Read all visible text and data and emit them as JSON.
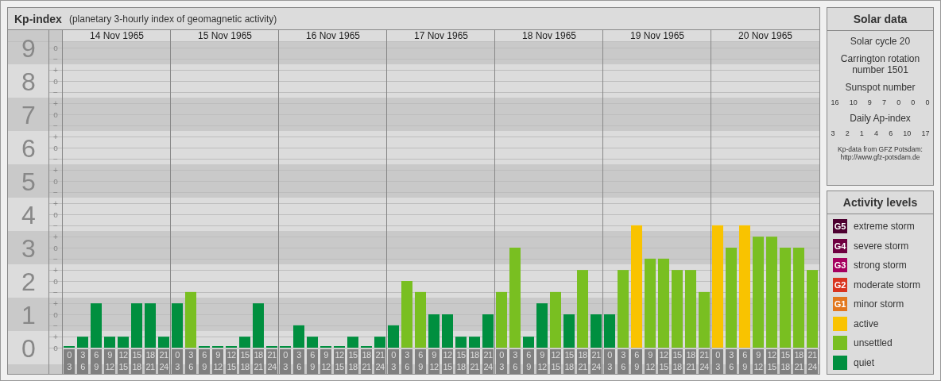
{
  "header": {
    "title": "Kp-index",
    "subtitle": "(planetary 3-hourly index of geomagnetic activity)"
  },
  "kp_subticks": [
    "o",
    "−",
    "+",
    "o",
    "−",
    "+",
    "o",
    "−",
    "+",
    "o",
    "−",
    "+",
    "o",
    "−",
    "+",
    "o",
    "−",
    "+",
    "o",
    "−",
    "+",
    "o",
    "−",
    "+",
    "o",
    "−",
    "+",
    "o"
  ],
  "days": [
    {
      "date": "14 Nov 1965"
    },
    {
      "date": "15 Nov 1965"
    },
    {
      "date": "16 Nov 1965"
    },
    {
      "date": "17 Nov 1965"
    },
    {
      "date": "18 Nov 1965"
    },
    {
      "date": "19 Nov 1965"
    },
    {
      "date": "20 Nov 1965"
    }
  ],
  "chart_data": {
    "type": "bar",
    "ylim": [
      0,
      9.5
    ],
    "yticks": [
      0,
      1,
      2,
      3,
      4,
      5,
      6,
      7,
      8,
      9
    ],
    "grid": true,
    "categories": [
      "0\n3",
      "3\n6",
      "6\n9",
      "9\n12",
      "12\n15",
      "15\n18",
      "18\n21",
      "21\n24",
      "0\n3",
      "3\n6",
      "6\n9",
      "9\n12",
      "12\n15",
      "15\n18",
      "18\n21",
      "21\n24",
      "0\n3",
      "3\n6",
      "6\n9",
      "9\n12",
      "12\n15",
      "15\n18",
      "18\n21",
      "21\n24",
      "0\n3",
      "3\n6",
      "6\n9",
      "9\n12",
      "12\n15",
      "15\n18",
      "18\n21",
      "21\n24",
      "0\n3",
      "3\n6",
      "6\n9",
      "9\n12",
      "12\n15",
      "15\n18",
      "18\n21",
      "21\n24",
      "0\n3",
      "3\n6",
      "6\n9",
      "9\n12",
      "12\n15",
      "15\n18",
      "18\n21",
      "21\n24",
      "0\n3",
      "3\n6",
      "6\n9",
      "9\n12",
      "12\n15",
      "15\n18",
      "18\n21",
      "21\n24"
    ],
    "series": [
      {
        "color": "#008f3f",
        "values": [
          0,
          0.33,
          1.33,
          0.33,
          0.33,
          1.33,
          1.33,
          0.33,
          1.33,
          null,
          0,
          0,
          0,
          0.33,
          1.33,
          0,
          0,
          0.67,
          0.33,
          0,
          0,
          0.33,
          0,
          0.33,
          0.67,
          null,
          null,
          1,
          1,
          0.33,
          0.33,
          1,
          null,
          null,
          0.33,
          1.33,
          null,
          1,
          null,
          1,
          1,
          null,
          null,
          null,
          null,
          null,
          null,
          null,
          null,
          null,
          null,
          null,
          null,
          null,
          null,
          null
        ]
      },
      {
        "color": "#79bf21",
        "values": [
          null,
          null,
          null,
          null,
          null,
          null,
          null,
          null,
          null,
          1.67,
          null,
          null,
          null,
          null,
          null,
          null,
          null,
          null,
          null,
          null,
          null,
          null,
          null,
          null,
          null,
          2,
          1.67,
          null,
          null,
          null,
          null,
          null,
          1.67,
          3,
          null,
          null,
          1.67,
          null,
          2.33,
          null,
          null,
          2.33,
          null,
          2.67,
          2.67,
          2.33,
          2.33,
          1.67,
          null,
          3,
          null,
          3.33,
          3.33,
          3,
          3,
          2.33
        ]
      },
      {
        "color": "#f9c300",
        "values": [
          null,
          null,
          null,
          null,
          null,
          null,
          null,
          null,
          null,
          null,
          null,
          null,
          null,
          null,
          null,
          null,
          null,
          null,
          null,
          null,
          null,
          null,
          null,
          null,
          null,
          null,
          null,
          null,
          null,
          null,
          null,
          null,
          null,
          null,
          null,
          null,
          null,
          null,
          null,
          null,
          null,
          null,
          3.67,
          null,
          null,
          null,
          null,
          null,
          3.67,
          null,
          3.67,
          null,
          null,
          null,
          null,
          null
        ]
      }
    ]
  },
  "solar_data": {
    "title": "Solar data",
    "cycle": "Solar cycle 20",
    "carrington": "Carrington rotation number 1501",
    "sunspot_label": "Sunspot number",
    "sunspot_numbers": [
      "16",
      "10",
      "9",
      "7",
      "0",
      "0",
      "0"
    ],
    "ap_label": "Daily Ap-index",
    "ap_values": [
      "3",
      "2",
      "1",
      "4",
      "6",
      "10",
      "17"
    ],
    "credit": "Kp-data from GFZ Potsdam:",
    "credit_link": "http://www.gfz-potsdam.de"
  },
  "activity_levels": {
    "title": "Activity levels",
    "items": [
      {
        "badge": "G5",
        "label": "extreme storm",
        "color": "#4d0030"
      },
      {
        "badge": "G4",
        "label": "severe storm",
        "color": "#6e0040"
      },
      {
        "badge": "G3",
        "label": "strong storm",
        "color": "#a5005f"
      },
      {
        "badge": "G2",
        "label": "moderate storm",
        "color": "#d9341f"
      },
      {
        "badge": "G1",
        "label": "minor storm",
        "color": "#e2781e"
      },
      {
        "label": "active",
        "color": "#f9c300"
      },
      {
        "label": "unsettled",
        "color": "#79bf21"
      },
      {
        "label": "quiet",
        "color": "#008f3f"
      }
    ]
  }
}
